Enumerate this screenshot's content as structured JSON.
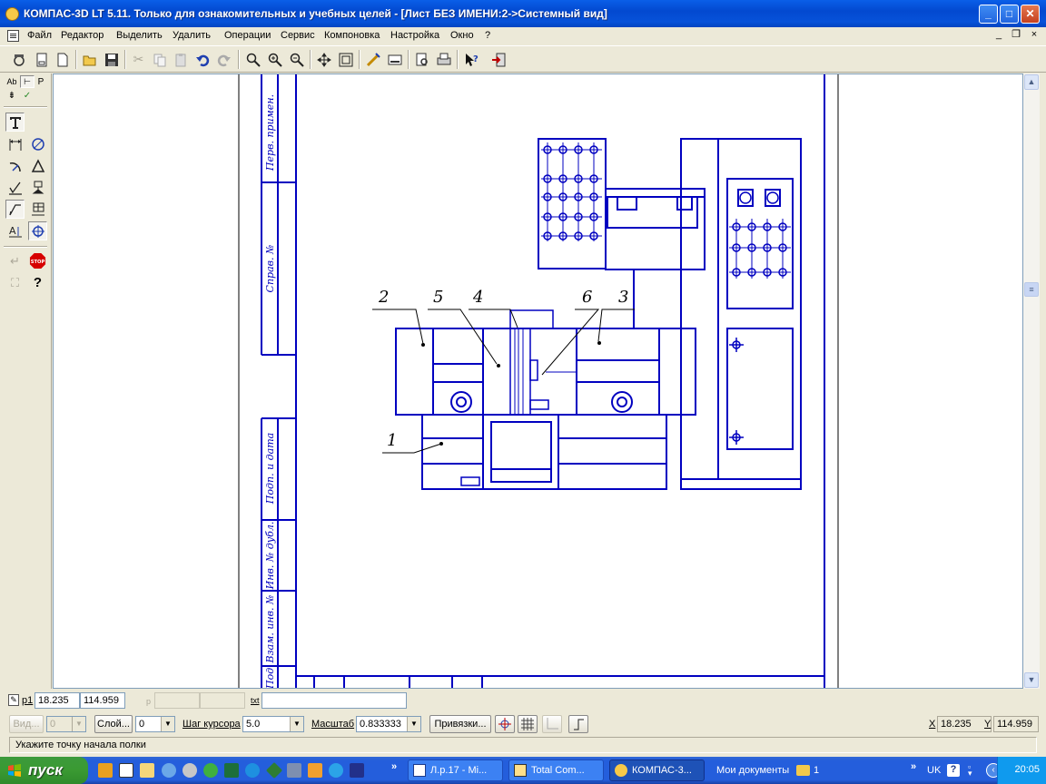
{
  "window": {
    "title": "КОМПАС-3D LT 5.11. Только для ознакомительных и учебных целей - [Лист БЕЗ ИМЕНИ:2->Системный вид]",
    "minimize_icon": "minimize-icon",
    "maximize_icon": "maximize-icon",
    "close_icon": "close-icon"
  },
  "menu": {
    "items": [
      "Файл",
      "Редактор",
      "Выделить",
      "Удалить",
      "Операции",
      "Сервис",
      "Компоновка",
      "Настройка",
      "Окно",
      "?"
    ],
    "mdi_minimize": "_",
    "mdi_restore": "❐",
    "mdi_close": "×"
  },
  "toolbar": {
    "buttons": [
      "new-document-icon",
      "new-sheet-icon",
      "new-fragment-icon",
      "open-icon",
      "save-icon",
      "cut-icon",
      "copy-icon",
      "paste-icon",
      "undo-icon",
      "redo-icon",
      "zoom-window-icon",
      "zoom-in-icon",
      "zoom-out-icon",
      "pan-icon",
      "show-all-icon",
      "refresh-icon",
      "properties-icon",
      "print-preview-icon",
      "print-icon",
      "context-help-icon",
      "exit-icon"
    ]
  },
  "left_panel": {
    "top_labels": [
      "Ab",
      "P"
    ],
    "buttons": [
      "text-icon",
      "dimension-icon",
      "measure-icon",
      "arc-icon",
      "triangle-icon",
      "roughness-icon",
      "base-icon",
      "leader-icon",
      "table-icon",
      "axis-mark-icon",
      "snap-icon",
      "enter-icon",
      "stop-icon",
      "select-icon",
      "help-icon"
    ],
    "stop_label": "STOP"
  },
  "drawing": {
    "positions": [
      "1",
      "2",
      "3",
      "4",
      "5",
      "6"
    ],
    "stamp_labels": [
      "Перв. примен.",
      "Справ. №",
      "Подп. и дата",
      "Инв. № дубл.",
      "Взам. инв. №"
    ],
    "stamp_partial": "Под",
    "line_color": "#0000C0"
  },
  "status": {
    "p1_label": "p1",
    "x_value": "18.235",
    "y_value": "114.959",
    "p_label": "p",
    "txt_label": "txt",
    "txt_value": "",
    "view_label": "Вид...",
    "view_value": "0",
    "layer_label": "Слой...",
    "layer_value": "0",
    "step_label": "Шаг курсора",
    "step_value": "5.0",
    "scale_label": "Масштаб",
    "scale_value": "0.833333",
    "snaps_label": "Привязки...",
    "coord_x_label": "X",
    "coord_x_value": "18.235",
    "coord_y_label": "Y",
    "coord_y_value": "114.959"
  },
  "prompt": {
    "text": "Укажите точку начала полки"
  },
  "taskbar": {
    "start_label": "пуск",
    "tasks": [
      "Л.р.17 - Mi...",
      "Total Com...",
      "КОМПАС-3..."
    ],
    "my_documents": "Мои документы",
    "folder_label": "1",
    "lang": "UK",
    "clock": "20:05"
  }
}
